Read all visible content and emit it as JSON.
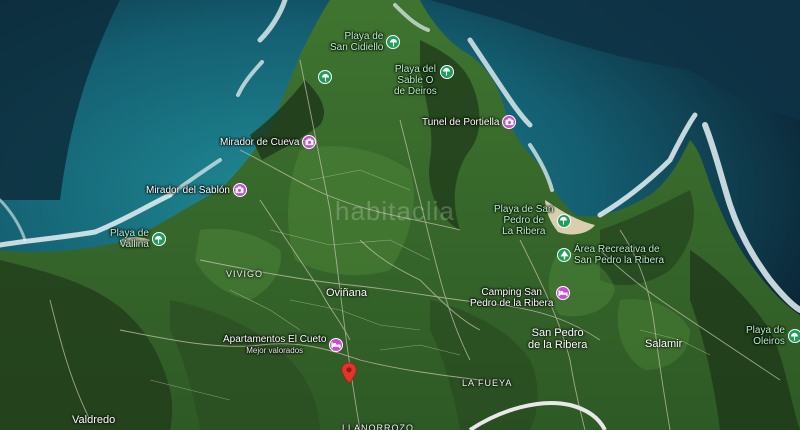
{
  "map": {
    "colors": {
      "deep_sea": "#0d2a3a",
      "shallow_sea": "#1f8a93",
      "land": "#3a6b2c",
      "dark_forest": "#1f3a1a",
      "surf": "#e6f2f4",
      "beach_sand": "#d9cfae",
      "highway": "#e8e8e8",
      "green_pin": "#1e9e5a",
      "pink_pin": "#c64fd6",
      "red_marker": "#e0352b"
    },
    "watermark": "habitaclia",
    "pois": [
      {
        "name": "Playa de San Cidiello",
        "lines": [
          "Playa de",
          "San Cidiello"
        ],
        "type": "beach",
        "icon": "beach-umbrella-icon",
        "color": "green"
      },
      {
        "name": "beach-umbrella-top",
        "lines": [],
        "type": "beach",
        "icon": "beach-umbrella-icon",
        "color": "green"
      },
      {
        "name": "Playa del Sable O de Deiros",
        "lines": [
          "Playa del",
          "Sable O",
          "de Deiros"
        ],
        "type": "beach",
        "icon": "beach-umbrella-icon",
        "color": "green"
      },
      {
        "name": "Tunel de Portiella",
        "lines": [
          "Tunel de Portiella"
        ],
        "type": "attraction",
        "icon": "camera-icon",
        "color": "pink"
      },
      {
        "name": "Mirador de Cueva",
        "lines": [
          "Mirador de Cueva"
        ],
        "type": "attraction",
        "icon": "camera-icon",
        "color": "pink"
      },
      {
        "name": "Mirador del Sablón",
        "lines": [
          "Mirador del Sablón"
        ],
        "type": "attraction",
        "icon": "camera-icon",
        "color": "pink"
      },
      {
        "name": "Playa de Vallina",
        "lines": [
          "Playa de",
          "Vallina"
        ],
        "type": "beach",
        "icon": "beach-umbrella-icon",
        "color": "green"
      },
      {
        "name": "Playa de San Pedro de La Ribera",
        "lines": [
          "Playa de San",
          "Pedro de",
          "La Ribera"
        ],
        "type": "beach",
        "icon": "beach-umbrella-icon",
        "color": "green"
      },
      {
        "name": "Área Recreativa de San Pedro la Ribera",
        "lines": [
          "Área Recreativa de",
          "San Pedro la Ribera"
        ],
        "type": "park",
        "icon": "tree-icon",
        "color": "green"
      },
      {
        "name": "Camping San Pedro de la Ribera",
        "lines": [
          "Camping San",
          "Pedro de la Ribera"
        ],
        "type": "lodging",
        "icon": "bed-icon",
        "color": "pink"
      },
      {
        "name": "Apartamentos El Cueto",
        "lines": [
          "Apartamentos El Cueto"
        ],
        "sub": "Mejor valorados",
        "type": "lodging",
        "icon": "bed-icon",
        "color": "pink"
      },
      {
        "name": "Playa de Oleiros",
        "lines": [
          "Playa de",
          "Oleiros"
        ],
        "type": "beach",
        "icon": "beach-umbrella-icon",
        "color": "green"
      }
    ],
    "places": [
      {
        "name": "Oviñana",
        "kind": "town"
      },
      {
        "name": "San Pedro de la Ribera",
        "lines": [
          "San Pedro",
          "de la Ribera"
        ],
        "kind": "town"
      },
      {
        "name": "Salamir",
        "kind": "town"
      },
      {
        "name": "Valdredo",
        "kind": "town"
      },
      {
        "name": "VIVIGO",
        "kind": "small"
      },
      {
        "name": "LA FUEYA",
        "kind": "small"
      },
      {
        "name": "LLANORROZO",
        "kind": "small"
      }
    ],
    "marker": {
      "name": "property-location",
      "icon": "map-pin-icon"
    }
  }
}
